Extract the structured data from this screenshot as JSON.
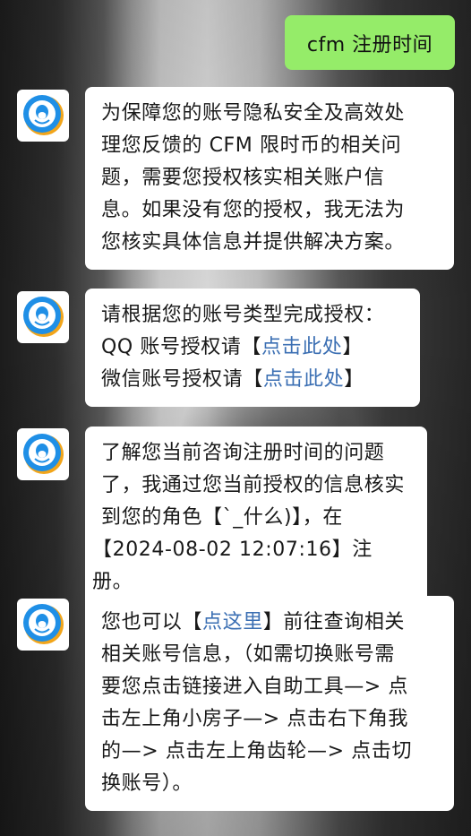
{
  "chat": {
    "outgoing": {
      "text": "cfm 注册时间"
    },
    "incoming": [
      {
        "lines": [
          "为保障您的账号隐私安全及高效处",
          "理您反馈的 CFM 限时币的相关问",
          "题，需要您授权核实相关账户信",
          "息。如果没有您的授权，我无法为",
          "您核实具体信息并提供解决方案。"
        ]
      },
      {
        "line1": "请根据您的账号类型完成授权：",
        "line2_prefix": "QQ 账号授权请【",
        "line2_link": "点击此处",
        "line2_suffix": "】",
        "line3_prefix": "微信账号授权请【",
        "line3_link": "点击此处",
        "line3_suffix": "】"
      },
      {
        "lines": [
          "了解您当前咨询注册时间的问题",
          "了，我通过您当前授权的信息核实",
          "到您的角色【`_什么)】，在",
          "【2024-08-02 12:07:16】注册。"
        ]
      },
      {
        "line1_prefix": "您也可以【",
        "line1_link": "点这里",
        "line1_suffix": "】前往查询相关",
        "lines_rest": [
          "相关账号信息，（如需切换账号需",
          "要您点击链接进入自助工具—> 点",
          "击左上角小房子—> 点击右下角我",
          "的—> 点击左上角齿轮—> 点击切",
          "换账号）。"
        ]
      }
    ]
  },
  "colors": {
    "outgoing_bubble": "#95ec69",
    "incoming_bubble": "#ffffff",
    "link": "#3b6fb3"
  },
  "icons": {
    "avatar": "qq-penguin-bot-avatar-icon"
  }
}
